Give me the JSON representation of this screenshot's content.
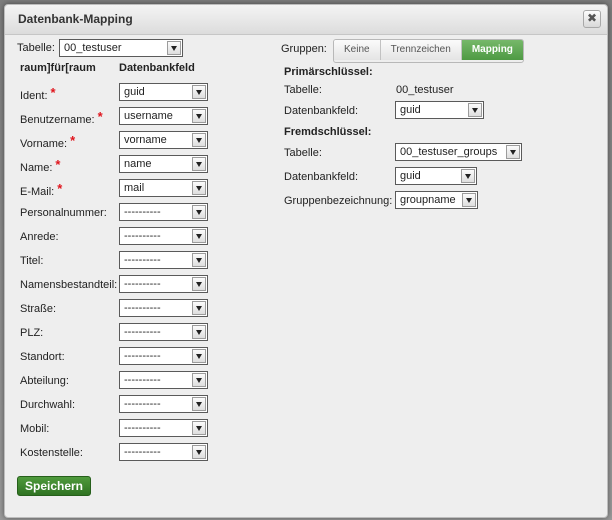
{
  "dialog": {
    "title": "Datenbank-Mapping",
    "close_glyph": "✖"
  },
  "left": {
    "table_label": "Tabelle:",
    "table_value": "00_testuser",
    "col_header_1": "raum]für[raum",
    "col_header_2": "Datenbankfeld",
    "rows": [
      {
        "label": "Ident:",
        "required": true,
        "value": "guid"
      },
      {
        "label": "Benutzername:",
        "required": true,
        "value": "username"
      },
      {
        "label": "Vorname:",
        "required": true,
        "value": "vorname"
      },
      {
        "label": "Name:",
        "required": true,
        "value": "name"
      },
      {
        "label": "E-Mail:",
        "required": true,
        "value": "mail"
      },
      {
        "label": "Personalnummer:",
        "required": false,
        "value": "----------"
      },
      {
        "label": "Anrede:",
        "required": false,
        "value": "----------"
      },
      {
        "label": "Titel:",
        "required": false,
        "value": "----------"
      },
      {
        "label": "Namensbestandteil:",
        "required": false,
        "value": "----------"
      },
      {
        "label": "Straße:",
        "required": false,
        "value": "----------"
      },
      {
        "label": "PLZ:",
        "required": false,
        "value": "----------"
      },
      {
        "label": "Standort:",
        "required": false,
        "value": "----------"
      },
      {
        "label": "Abteilung:",
        "required": false,
        "value": "----------"
      },
      {
        "label": "Durchwahl:",
        "required": false,
        "value": "----------"
      },
      {
        "label": "Mobil:",
        "required": false,
        "value": "----------"
      },
      {
        "label": "Kostenstelle:",
        "required": false,
        "value": "----------"
      }
    ],
    "required_marker": "*"
  },
  "right": {
    "groups_label": "Gruppen:",
    "groups_options": [
      "Keine",
      "Trennzeichen",
      "Mapping"
    ],
    "groups_selected": "Mapping",
    "primary_header": "Primärschlüssel:",
    "primary_table_label": "Tabelle:",
    "primary_table_value": "00_testuser",
    "primary_field_label": "Datenbankfeld:",
    "primary_field_value": "guid",
    "foreign_header": "Fremdschlüssel:",
    "foreign_table_label": "Tabelle:",
    "foreign_table_value": "00_testuser_groups",
    "foreign_field_label": "Datenbankfeld:",
    "foreign_field_value": "guid",
    "group_name_label": "Gruppenbezeichnung:",
    "group_name_value": "groupname"
  },
  "footer": {
    "save_label": "Speichern"
  },
  "colors": {
    "accent_green": "#4e9a43",
    "required_red": "#e0141c"
  }
}
